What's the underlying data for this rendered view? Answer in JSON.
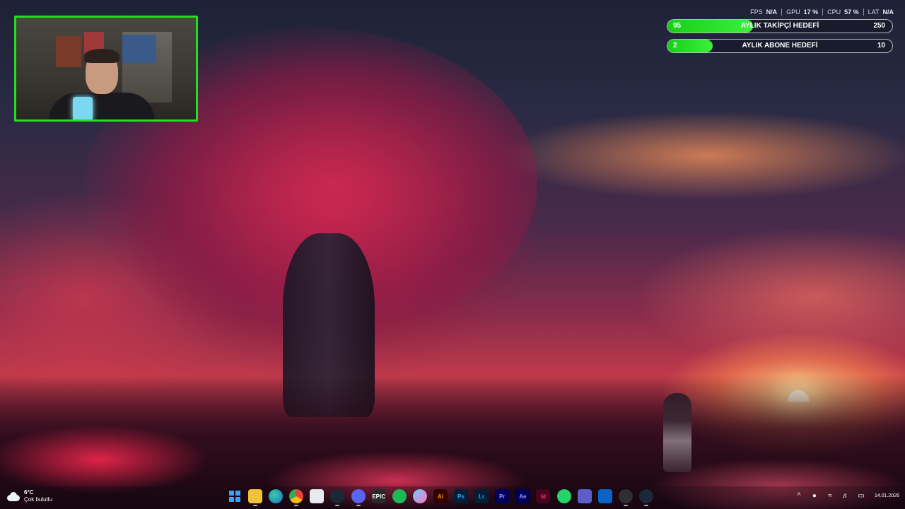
{
  "overlay": {
    "stats": [
      {
        "label": "FPS",
        "value": "N/A"
      },
      {
        "label": "GPU",
        "value": "17 %"
      },
      {
        "label": "CPU",
        "value": "57 %"
      },
      {
        "label": "LAT",
        "value": "N/A"
      }
    ],
    "goals": [
      {
        "current": "95",
        "title": "AYLIK TAKİPÇİ HEDEFİ",
        "target": "250",
        "progress": 0.38
      },
      {
        "current": "2",
        "title": "AYLIK ABONE HEDEFİ",
        "target": "10",
        "progress": 0.2
      }
    ]
  },
  "taskbar": {
    "weather": {
      "temp": "6°C",
      "condition": "Çok bulutlu"
    },
    "apps": [
      {
        "name": "start-icon",
        "label": ""
      },
      {
        "name": "file-explorer-icon",
        "label": ""
      },
      {
        "name": "edge-icon",
        "label": ""
      },
      {
        "name": "chrome-icon",
        "label": ""
      },
      {
        "name": "store-icon",
        "label": ""
      },
      {
        "name": "steam-icon",
        "label": ""
      },
      {
        "name": "discord-icon",
        "label": ""
      },
      {
        "name": "epic-games-icon",
        "label": "EPIC"
      },
      {
        "name": "spotify-icon",
        "label": ""
      },
      {
        "name": "app-icon",
        "label": ""
      },
      {
        "name": "illustrator-icon",
        "label": "Ai"
      },
      {
        "name": "photoshop-icon",
        "label": "Ps"
      },
      {
        "name": "lightroom-icon",
        "label": "Lr"
      },
      {
        "name": "premiere-icon",
        "label": "Pr"
      },
      {
        "name": "after-effects-icon",
        "label": "Ae"
      },
      {
        "name": "indesign-icon",
        "label": "Id"
      },
      {
        "name": "whatsapp-icon",
        "label": ""
      },
      {
        "name": "teams-icon",
        "label": ""
      },
      {
        "name": "outlook-icon",
        "label": ""
      },
      {
        "name": "obs-icon",
        "label": ""
      },
      {
        "name": "steam-icon",
        "label": ""
      }
    ],
    "tray": {
      "icons": [
        "chevron-up-icon",
        "microphone-icon",
        "wifi-icon",
        "volume-icon",
        "battery-icon"
      ],
      "time": "",
      "date": "14.01.2026"
    }
  }
}
